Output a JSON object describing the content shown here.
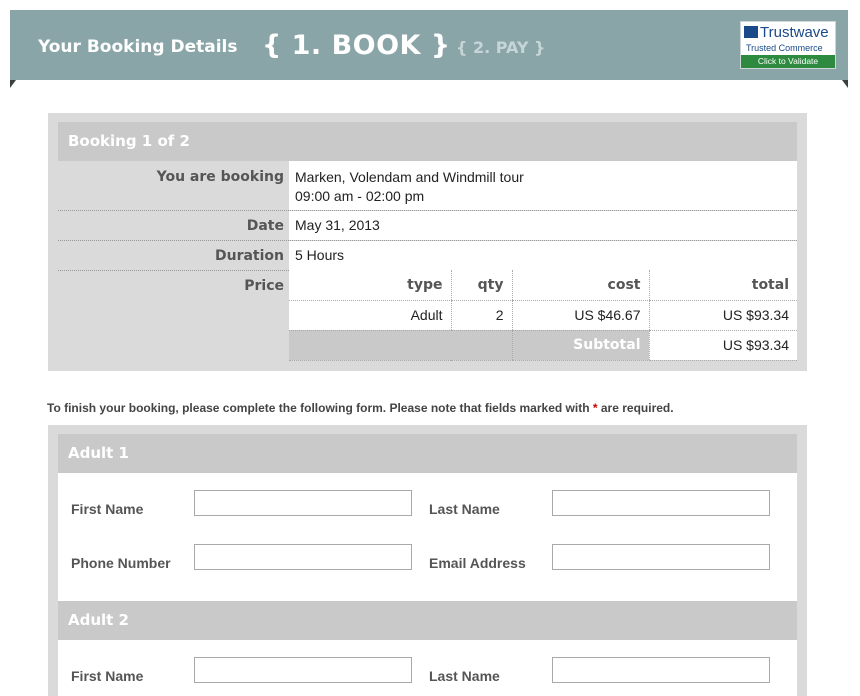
{
  "header": {
    "title": "Your Booking Details",
    "step_active": "{ 1. BOOK }",
    "step_next": "{ 2. PAY }",
    "trust_logo": "Trustwave",
    "trust_sub": "Trusted Commerce",
    "trust_button": "Click to Validate"
  },
  "booking": {
    "heading": "Booking 1 of 2",
    "you_are_booking_label": "You are booking",
    "tour_name": "Marken, Volendam and Windmill tour",
    "tour_time": "09:00 am - 02:00 pm",
    "date_label": "Date",
    "date_value": "May 31, 2013",
    "duration_label": "Duration",
    "duration_value": "5 Hours",
    "price_label": "Price",
    "price_table": {
      "headers": [
        "type",
        "qty",
        "cost",
        "total"
      ],
      "rows": [
        {
          "type": "Adult",
          "qty": "2",
          "cost": "US $46.67",
          "total": "US $93.34"
        }
      ],
      "subtotal_label": "Subtotal",
      "subtotal_value": "US $93.34"
    }
  },
  "instructions": {
    "text_before": "To finish your booking, please complete the following form. Please note that fields marked with ",
    "star": "*",
    "text_after": "are required."
  },
  "form": {
    "sections": [
      {
        "heading": "Adult 1",
        "first_name_label": "First Name",
        "last_name_label": "Last Name",
        "phone_label": "Phone Number",
        "email_label": "Email Address",
        "first_name_value": "",
        "last_name_value": "",
        "phone_value": "",
        "email_value": ""
      },
      {
        "heading": "Adult 2",
        "first_name_label": "First Name",
        "last_name_label": "Last Name",
        "first_name_value": "",
        "last_name_value": ""
      }
    ]
  }
}
